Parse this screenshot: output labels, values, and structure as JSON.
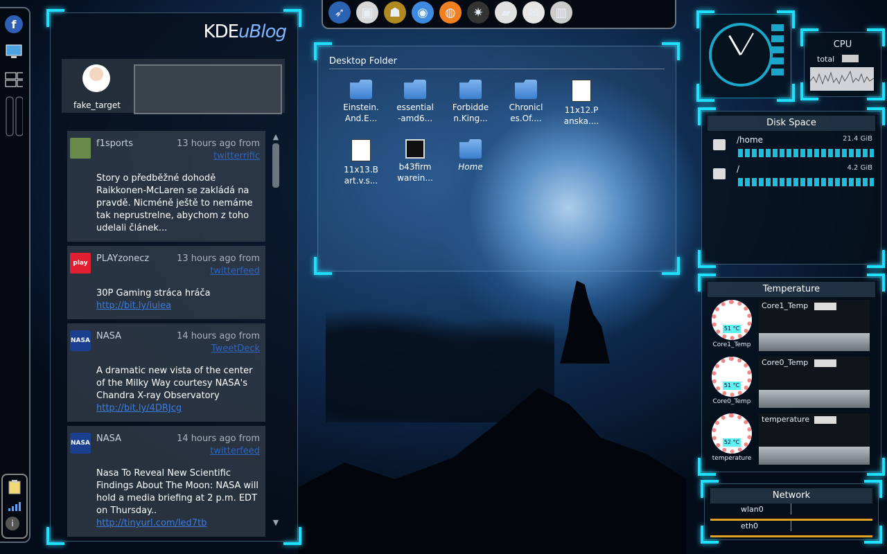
{
  "dock": {
    "icons": [
      "fedora-icon",
      "display-settings-icon",
      "desktop-grid-icon",
      "panel-toggle-icon"
    ],
    "tray": [
      "clipboard-icon",
      "network-signal-icon",
      "info-icon"
    ],
    "fedora_glyph": "f",
    "info_glyph": "i"
  },
  "launcher": {
    "items": [
      {
        "name": "launcher-thunderbird-icon",
        "glyph": "➶",
        "bg": "#2b62b2"
      },
      {
        "name": "launcher-terminal-icon",
        "glyph": "▣",
        "bg": "#d8d8d8"
      },
      {
        "name": "launcher-games-icon",
        "glyph": "☗",
        "bg": "#b08a20"
      },
      {
        "name": "launcher-browser-icon",
        "glyph": "◉",
        "bg": "#3d8ae0"
      },
      {
        "name": "launcher-blender-icon",
        "glyph": "◍",
        "bg": "#f08020"
      },
      {
        "name": "launcher-settings-icon",
        "glyph": "✷",
        "bg": "#333333"
      },
      {
        "name": "launcher-disk-icon",
        "glyph": "▰",
        "bg": "#e0e0e0"
      },
      {
        "name": "launcher-network-icon",
        "glyph": "✉",
        "bg": "#e6e6e6"
      },
      {
        "name": "launcher-trash-icon",
        "glyph": "▥",
        "bg": "#cccccc"
      }
    ]
  },
  "blog": {
    "logo_prefix": "KDE",
    "logo_suffix": "uBlog",
    "username": "fake_target",
    "posts": [
      {
        "name": "f1sports",
        "time": "13 hours ago from",
        "source": "twitterrific",
        "text": "Story o předběžné dohodě Raikkonen-McLaren se zakládá na pravdě. Nicméně ještě to nemáme tak neprustrelne, abychom z toho udelali článek...",
        "link": "",
        "avatar_bg": "#6a8a4a",
        "avatar_text": ""
      },
      {
        "name": "PLAYzonecz",
        "time": "13 hours ago from",
        "source": "twitterfeed",
        "text": "30P Gaming stráca hráča",
        "link": "http://bit.ly/iuiea",
        "avatar_bg": "#e02030",
        "avatar_text": "play"
      },
      {
        "name": "NASA",
        "time": "14 hours ago from",
        "source": "TweetDeck",
        "text": "A dramatic new vista of the center of the Milky Way courtesy NASA's Chandra X-ray Observatory",
        "link": "http://bit.ly/4DRJcg",
        "avatar_bg": "#1a3f8f",
        "avatar_text": "NASA"
      },
      {
        "name": "NASA",
        "time": "14 hours ago from",
        "source": "twitterfeed",
        "text": "Nasa To Reveal New Scientific Findings About The Moon: NASA will hold a media briefing at 2 p.m. EDT on Thursday..",
        "link": "http://tinyurl.com/led7tb",
        "avatar_bg": "#1a3f8f",
        "avatar_text": "NASA"
      }
    ]
  },
  "folder": {
    "title": "Desktop Folder",
    "items": [
      {
        "label": "Einstein.\nAnd.E...",
        "type": "dir"
      },
      {
        "label": "essential\n-amd6...",
        "type": "dir"
      },
      {
        "label": "Forbidde\nn.King...",
        "type": "dir"
      },
      {
        "label": "Chronicl\nes.Of....",
        "type": "dir"
      },
      {
        "label": "11x12.P\nanska....",
        "type": "doc"
      },
      {
        "label": "11x13.B\nart.v.s...",
        "type": "doc"
      },
      {
        "label": "b43firm\nwarein...",
        "type": "term"
      },
      {
        "label": "Home",
        "type": "dir"
      }
    ]
  },
  "cpu": {
    "title": "CPU",
    "label": "total"
  },
  "disk": {
    "title": "Disk Space",
    "items": [
      {
        "mount": "/home",
        "size": "21.4 GiB"
      },
      {
        "mount": "/",
        "size": "4.2 GiB"
      }
    ]
  },
  "temperature": {
    "title": "Temperature",
    "sensors": [
      {
        "name": "Core1_Temp",
        "reading": "51 °C"
      },
      {
        "name": "Core0_Temp",
        "reading": "51 °C"
      },
      {
        "name": "temperature",
        "reading": "52 °C"
      }
    ]
  },
  "network": {
    "title": "Network",
    "interfaces": [
      "wlan0",
      "eth0"
    ]
  },
  "colors": {
    "accent": "#20e0ff",
    "link": "#3b7de0"
  }
}
